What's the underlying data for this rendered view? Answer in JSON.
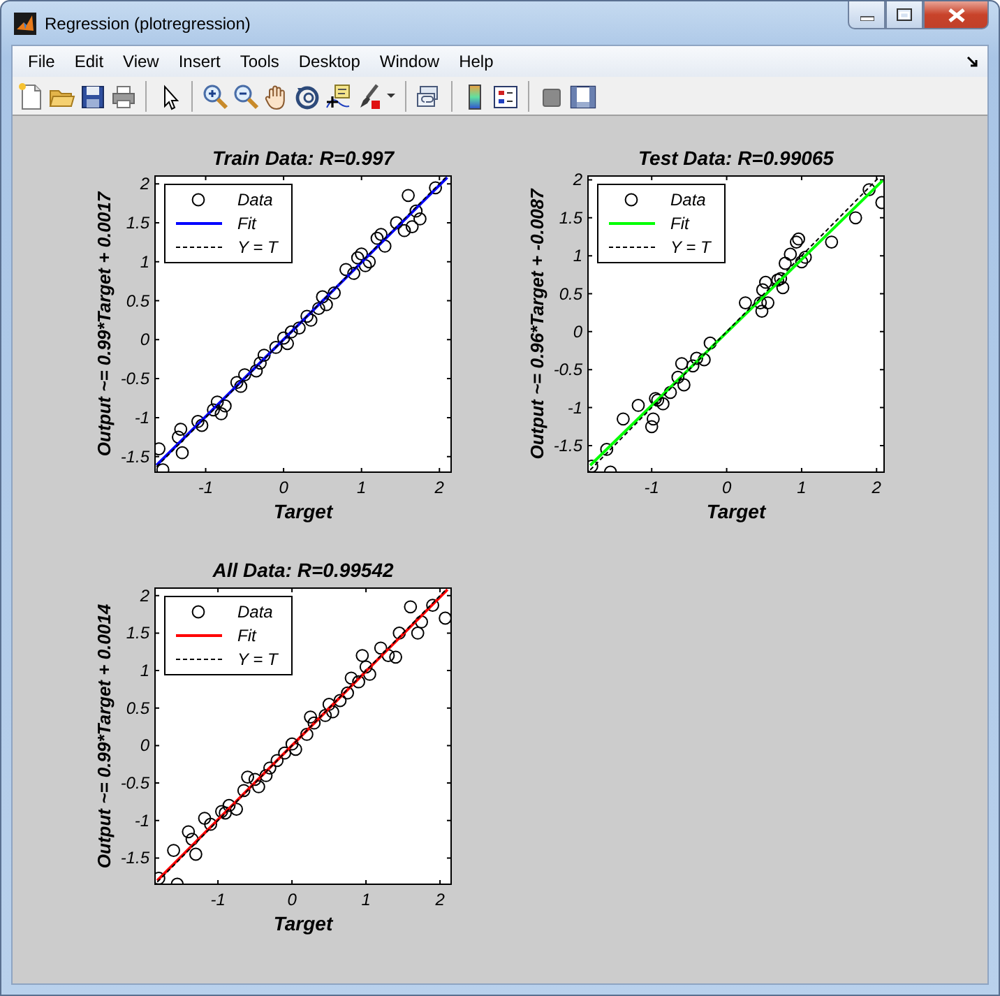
{
  "window": {
    "title": "Regression (plotregression)"
  },
  "menu": [
    "File",
    "Edit",
    "View",
    "Insert",
    "Tools",
    "Desktop",
    "Window",
    "Help"
  ],
  "plots": [
    {
      "chart_data": {
        "type": "scatter",
        "title": "Train Data: R=0.997",
        "xlabel": "Target",
        "ylabel": "Output ~= 0.99*Target + 0.0017",
        "xlim": [
          -1.65,
          2.15
        ],
        "ylim": [
          -1.7,
          2.1
        ],
        "xticks": [
          -1,
          0,
          1,
          2
        ],
        "yticks": [
          -1.5,
          -1,
          -0.5,
          0,
          0.5,
          1,
          1.5,
          2
        ],
        "series": [
          {
            "name": "Data",
            "type": "scatter",
            "color": "#000000",
            "x": [
              -1.6,
              -1.55,
              -1.35,
              -1.3,
              -1.32,
              -1.1,
              -1.05,
              -0.9,
              -0.85,
              -0.8,
              -0.75,
              -0.6,
              -0.55,
              -0.5,
              -0.35,
              -0.3,
              -0.25,
              -0.1,
              0,
              0.05,
              0.1,
              0.2,
              0.3,
              0.35,
              0.45,
              0.5,
              0.55,
              0.65,
              0.8,
              0.9,
              0.95,
              1.0,
              1.05,
              1.1,
              1.2,
              1.25,
              1.3,
              1.45,
              1.55,
              1.6,
              1.65,
              1.7,
              1.75,
              1.95
            ],
            "values": [
              -1.4,
              -1.67,
              -1.25,
              -1.45,
              -1.15,
              -1.05,
              -1.1,
              -0.9,
              -0.8,
              -0.95,
              -0.85,
              -0.55,
              -0.6,
              -0.45,
              -0.4,
              -0.3,
              -0.2,
              -0.1,
              0.02,
              -0.05,
              0.1,
              0.15,
              0.3,
              0.25,
              0.4,
              0.55,
              0.45,
              0.6,
              0.9,
              0.85,
              1.05,
              1.1,
              0.95,
              1.0,
              1.3,
              1.35,
              1.2,
              1.5,
              1.4,
              1.85,
              1.45,
              1.65,
              1.55,
              1.95
            ]
          },
          {
            "name": "Fit",
            "type": "line",
            "color": "#0000ff",
            "x": [
              -1.63,
              2.1
            ],
            "values": [
              -1.61,
              2.08
            ]
          },
          {
            "name": "Y = T",
            "type": "line",
            "line_style": "dashed",
            "color": "#000000",
            "x": [
              -1.63,
              2.08
            ],
            "values": [
              -1.63,
              2.08
            ]
          }
        ],
        "legend": true
      }
    },
    {
      "chart_data": {
        "type": "scatter",
        "title": "Test Data: R=0.99065",
        "xlabel": "Target",
        "ylabel": "Output ~= 0.96*Target + -0.0087",
        "xlim": [
          -1.85,
          2.1
        ],
        "ylim": [
          -1.85,
          2.05
        ],
        "xticks": [
          -1,
          0,
          1,
          2
        ],
        "yticks": [
          -1.5,
          -1,
          -0.5,
          0,
          0.5,
          1,
          1.5,
          2
        ],
        "series": [
          {
            "name": "Data",
            "type": "scatter",
            "color": "#000000",
            "x": [
              -1.8,
              -1.6,
              -1.55,
              -1.38,
              -1.18,
              -1.0,
              -0.98,
              -0.95,
              -0.92,
              -0.85,
              -0.75,
              -0.65,
              -0.6,
              -0.57,
              -0.45,
              -0.4,
              -0.3,
              -0.22,
              0.25,
              0.45,
              0.47,
              0.48,
              0.52,
              0.55,
              0.68,
              0.72,
              0.75,
              0.78,
              0.85,
              0.93,
              0.96,
              1.0,
              1.05,
              1.4,
              1.72,
              1.9,
              2.07
            ],
            "values": [
              -1.77,
              -1.55,
              -1.85,
              -1.15,
              -0.97,
              -1.25,
              -1.15,
              -0.88,
              -0.9,
              -0.95,
              -0.8,
              -0.6,
              -0.42,
              -0.7,
              -0.45,
              -0.35,
              -0.37,
              -0.15,
              0.38,
              0.38,
              0.27,
              0.55,
              0.65,
              0.38,
              0.68,
              0.7,
              0.58,
              0.9,
              1.02,
              1.18,
              1.22,
              0.92,
              0.98,
              1.18,
              1.5,
              1.87,
              1.7
            ]
          },
          {
            "name": "Fit",
            "type": "line",
            "color": "#00ff00",
            "x": [
              -1.82,
              2.08
            ],
            "values": [
              -1.76,
              1.99
            ]
          },
          {
            "name": "Y = T",
            "type": "line",
            "line_style": "dashed",
            "color": "#000000",
            "x": [
              -1.82,
              2.03
            ],
            "values": [
              -1.82,
              2.03
            ]
          }
        ],
        "legend": true
      }
    },
    {
      "chart_data": {
        "type": "scatter",
        "title": "All Data: R=0.99542",
        "xlabel": "Target",
        "ylabel": "Output ~= 0.99*Target + 0.0014",
        "xlim": [
          -1.85,
          2.15
        ],
        "ylim": [
          -1.85,
          2.1
        ],
        "xticks": [
          -1,
          0,
          1,
          2
        ],
        "yticks": [
          -1.5,
          -1,
          -0.5,
          0,
          0.5,
          1,
          1.5,
          2
        ],
        "series": [
          {
            "name": "Data",
            "type": "scatter",
            "color": "#000000",
            "x": [
              -1.8,
              -1.6,
              -1.55,
              -1.4,
              -1.35,
              -1.3,
              -1.18,
              -1.1,
              -0.95,
              -0.9,
              -0.85,
              -0.75,
              -0.65,
              -0.6,
              -0.5,
              -0.45,
              -0.35,
              -0.3,
              -0.2,
              -0.1,
              0,
              0.05,
              0.2,
              0.25,
              0.3,
              0.45,
              0.5,
              0.55,
              0.65,
              0.75,
              0.8,
              0.9,
              0.95,
              1.0,
              1.05,
              1.2,
              1.3,
              1.4,
              1.45,
              1.6,
              1.7,
              1.75,
              1.9,
              2.07
            ],
            "values": [
              -1.77,
              -1.4,
              -1.85,
              -1.15,
              -1.25,
              -1.45,
              -0.97,
              -1.05,
              -0.88,
              -0.9,
              -0.8,
              -0.85,
              -0.6,
              -0.42,
              -0.45,
              -0.55,
              -0.4,
              -0.3,
              -0.2,
              -0.1,
              0.02,
              -0.05,
              0.15,
              0.38,
              0.3,
              0.4,
              0.55,
              0.45,
              0.6,
              0.7,
              0.9,
              0.85,
              1.2,
              1.05,
              0.95,
              1.3,
              1.2,
              1.18,
              1.5,
              1.85,
              1.5,
              1.65,
              1.87,
              1.7
            ]
          },
          {
            "name": "Fit",
            "type": "line",
            "color": "#ff0000",
            "x": [
              -1.82,
              2.1
            ],
            "values": [
              -1.8,
              2.08
            ]
          },
          {
            "name": "Y = T",
            "type": "line",
            "line_style": "dashed",
            "color": "#000000",
            "x": [
              -1.82,
              2.08
            ],
            "values": [
              -1.82,
              2.08
            ]
          }
        ],
        "legend": true
      }
    }
  ]
}
